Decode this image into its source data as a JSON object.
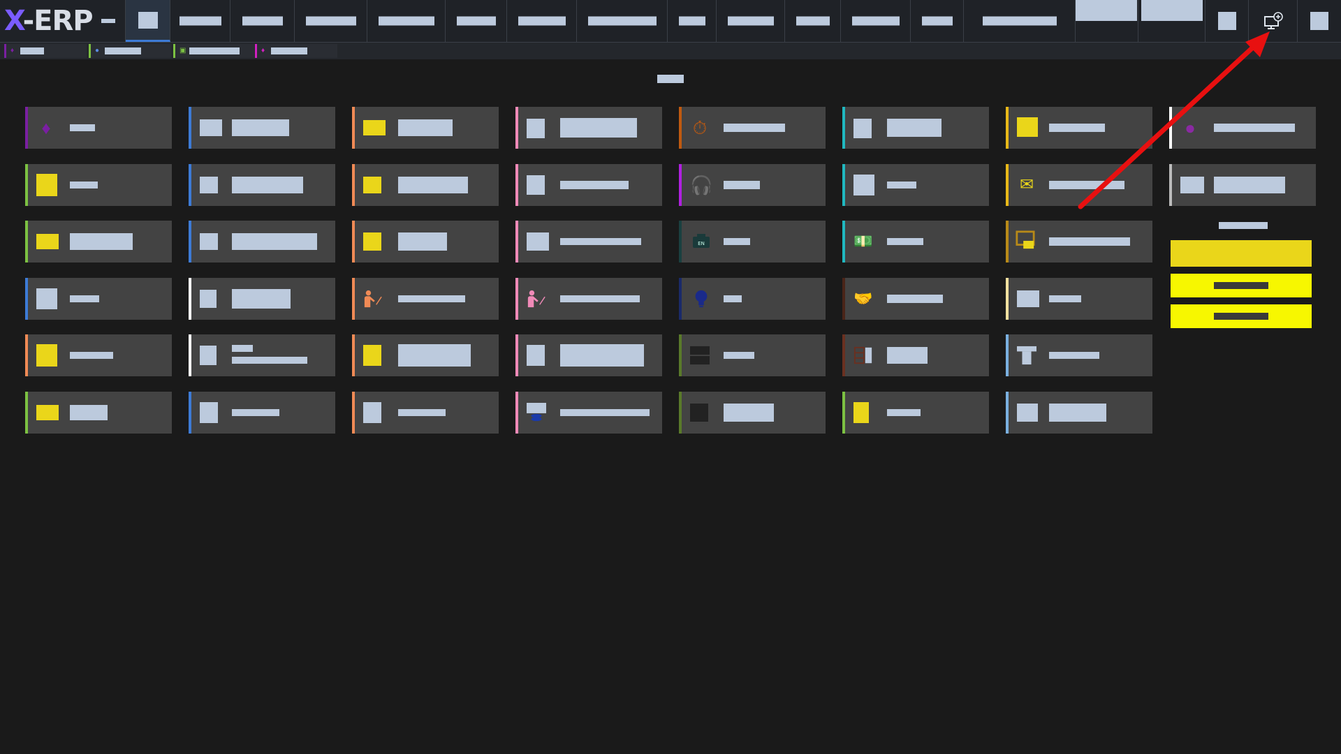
{
  "app": {
    "logo_x": "X",
    "logo_rest": "-ERP",
    "accent_color": "#3d7bd6",
    "background_color": "#1a1a1a"
  },
  "topnav": {
    "icons": [
      "menu-icon",
      "home-icon",
      "settings-icon",
      "add-screen-icon",
      "user-icon"
    ]
  },
  "tabs": [
    {
      "icon": "gem-icon",
      "color": "#7a1fa2"
    },
    {
      "icon": "user-icon",
      "color": "#7cc142"
    },
    {
      "icon": "image-icon",
      "color": "#7cc142"
    },
    {
      "icon": "gem-icon",
      "color": "#d020c0"
    }
  ],
  "tiles": [
    {
      "icon": "gem-icon",
      "border": "#7a1fa2"
    },
    {
      "icon": "blank-icon",
      "border": "#3d7bd6"
    },
    {
      "icon": "yellow-icon",
      "border": "#f08a55"
    },
    {
      "icon": "blank-icon",
      "border": "#f08ab8"
    },
    {
      "icon": "stopwatch-icon",
      "border": "#c05a10"
    },
    {
      "icon": "blank-icon",
      "border": "#20b8c0"
    },
    {
      "icon": "yellow-icon",
      "border": "#e8b818"
    },
    {
      "icon": "gem-icon",
      "border": "#ffffff"
    },
    {
      "icon": "yellow-icon",
      "border": "#7cc142"
    },
    {
      "icon": "blank-icon",
      "border": "#3d7bd6"
    },
    {
      "icon": "yellow-icon",
      "border": "#f08a55"
    },
    {
      "icon": "blank-icon",
      "border": "#f08ab8"
    },
    {
      "icon": "headset-icon",
      "border": "#b020e0"
    },
    {
      "icon": "blank-icon",
      "border": "#20b8c0"
    },
    {
      "icon": "mail-question-icon",
      "border": "#e8b818"
    },
    {
      "icon": "blank-icon",
      "border": "#bcbcbc"
    },
    {
      "icon": "yellow-icon",
      "border": "#7cc142"
    },
    {
      "icon": "blank-icon",
      "border": "#3d7bd6"
    },
    {
      "icon": "yellow-icon",
      "border": "#f08a55"
    },
    {
      "icon": "blank-icon",
      "border": "#f08ab8"
    },
    {
      "icon": "engine-icon",
      "border": "#1a4040"
    },
    {
      "icon": "money-icon",
      "border": "#20b8c0"
    },
    {
      "icon": "presentation-icon",
      "border": "#b88a18"
    },
    {
      "icon": "blank-icon",
      "border": "#3d7bd6"
    },
    {
      "icon": "blank-icon",
      "border": "#ffffff"
    },
    {
      "icon": "teacher-icon",
      "border": "#f08a55"
    },
    {
      "icon": "teacher-icon",
      "border": "#f08ab8"
    },
    {
      "icon": "lightbulb-icon",
      "border": "#1a2a6a"
    },
    {
      "icon": "handshake-icon",
      "border": "#4a2418"
    },
    {
      "icon": "blank-icon",
      "border": "#f0e0a0"
    },
    {
      "icon": "yellow-icon",
      "border": "#f08a55"
    },
    {
      "icon": "blank-icon",
      "border": "#ffffff"
    },
    {
      "icon": "yellow-icon",
      "border": "#f08a55"
    },
    {
      "icon": "blank-icon",
      "border": "#f08ab8"
    },
    {
      "icon": "stack-icon",
      "border": "#5a7a2a"
    },
    {
      "icon": "list-icon",
      "border": "#6a3020"
    },
    {
      "icon": "desk-icon",
      "border": "#7ab0e0"
    },
    {
      "icon": "yellow-icon",
      "border": "#7cc142"
    },
    {
      "icon": "blank-icon",
      "border": "#3d7bd6"
    },
    {
      "icon": "blank-icon",
      "border": "#f08a55"
    },
    {
      "icon": "database-icon",
      "border": "#f08ab8"
    },
    {
      "icon": "dark-square-icon",
      "border": "#5a7a2a"
    },
    {
      "icon": "yellow-icon",
      "border": "#7cc142"
    },
    {
      "icon": "blank-icon",
      "border": "#7ab0e0"
    }
  ],
  "right_panel": {
    "button_colors": [
      "#ead61a",
      "#f7f700",
      "#f7f700"
    ]
  }
}
